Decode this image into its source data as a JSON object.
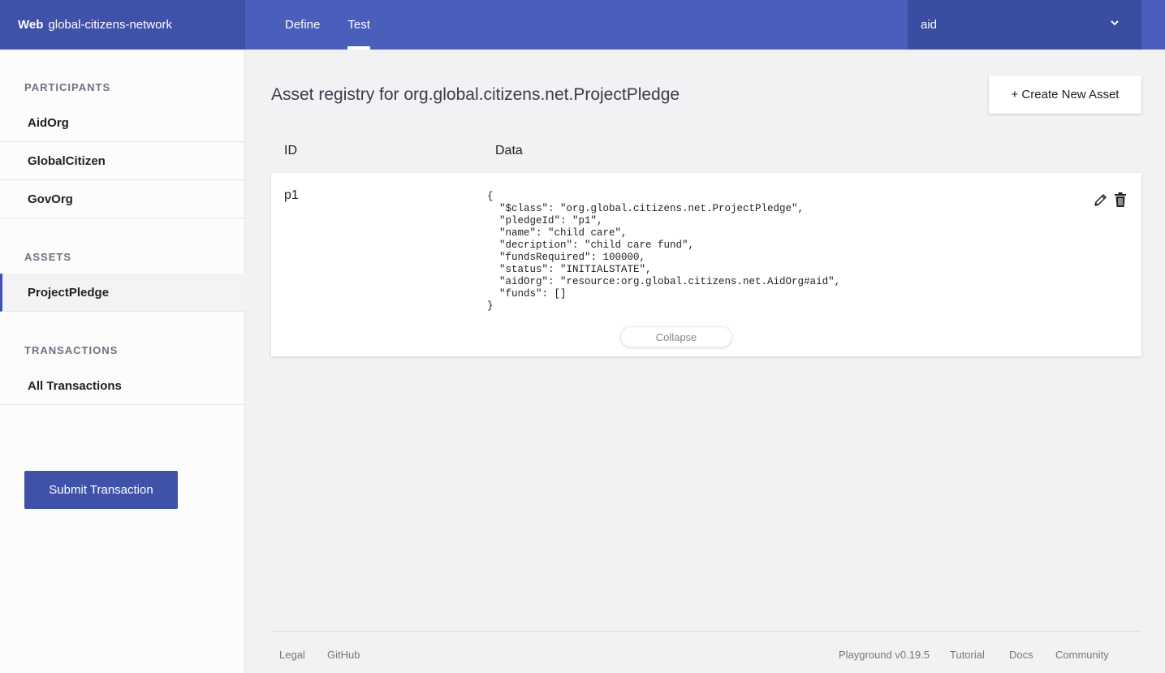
{
  "header": {
    "brand_bold": "Web",
    "brand_name": "global-citizens-network",
    "tabs": [
      {
        "label": "Define",
        "active": false
      },
      {
        "label": "Test",
        "active": true
      }
    ],
    "identity_value": "aid",
    "colors": {
      "bar": "#4a5fbb",
      "brand": "#3f51a9",
      "identity": "#3b4da0"
    }
  },
  "sidebar": {
    "participants_title": "PARTICIPANTS",
    "participants": [
      "AidOrg",
      "GlobalCitizen",
      "GovOrg"
    ],
    "assets_title": "ASSETS",
    "assets": [
      "ProjectPledge"
    ],
    "active_asset": "ProjectPledge",
    "transactions_title": "TRANSACTIONS",
    "transactions": [
      "All Transactions"
    ],
    "submit_label": "Submit Transaction"
  },
  "main": {
    "title": "Asset registry for org.global.citizens.net.ProjectPledge",
    "create_label": "+ Create New Asset",
    "columns": {
      "id": "ID",
      "data": "Data"
    },
    "rows": [
      {
        "id": "p1",
        "data": "{\n  \"$class\": \"org.global.citizens.net.ProjectPledge\",\n  \"pledgeId\": \"p1\",\n  \"name\": \"child care\",\n  \"decription\": \"child care fund\",\n  \"fundsRequired\": 100000,\n  \"status\": \"INITIALSTATE\",\n  \"aidOrg\": \"resource:org.global.citizens.net.AidOrg#aid\",\n  \"funds\": []\n}",
        "collapse_label": "Collapse",
        "edit_icon": "pencil-icon",
        "delete_icon": "trash-icon"
      }
    ]
  },
  "footer": {
    "left": [
      "Legal",
      "GitHub"
    ],
    "version": "Playground v0.19.5",
    "right": [
      "Tutorial",
      "Docs",
      "Community"
    ]
  }
}
